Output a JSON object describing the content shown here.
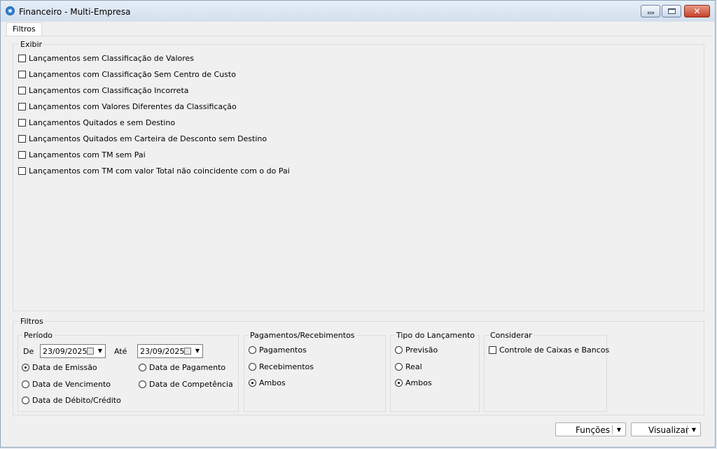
{
  "window": {
    "title": "Financeiro - Multi-Empresa"
  },
  "tabs": [
    {
      "label": "Filtros"
    }
  ],
  "exibir": {
    "caption": "Exibir",
    "items": [
      {
        "label": "Lançamentos sem Classificação de Valores",
        "checked": false
      },
      {
        "label": "Lançamentos com Classificação Sem Centro de Custo",
        "checked": false
      },
      {
        "label": "Lançamentos com Classificação Incorreta",
        "checked": false
      },
      {
        "label": "Lançamentos com Valores Diferentes da Classificação",
        "checked": false
      },
      {
        "label": "Lançamentos Quitados e sem Destino",
        "checked": false
      },
      {
        "label": "Lançamentos Quitados em Carteira de Desconto sem Destino",
        "checked": false
      },
      {
        "label": "Lançamentos com TM sem Pai",
        "checked": false
      },
      {
        "label": "Lançamentos com TM com valor Total não coincidente com o do Pai",
        "checked": false
      }
    ]
  },
  "filtros": {
    "caption": "Filtros",
    "periodo": {
      "caption": "Período",
      "de_label": "De",
      "de_value": "23/09/2025",
      "ate_label": "Até",
      "ate_value": "23/09/2025",
      "options": [
        {
          "label": "Data de Emissão",
          "selected": true
        },
        {
          "label": "Data de Pagamento",
          "selected": false
        },
        {
          "label": "Data de Vencimento",
          "selected": false
        },
        {
          "label": "Data de Competência",
          "selected": false
        },
        {
          "label": "Data de Débito/Crédito",
          "selected": false
        }
      ]
    },
    "pagamentos": {
      "caption": "Pagamentos/Recebimentos",
      "options": [
        {
          "label": "Pagamentos",
          "selected": false
        },
        {
          "label": "Recebimentos",
          "selected": false
        },
        {
          "label": "Ambos",
          "selected": true
        }
      ]
    },
    "tipo": {
      "caption": "Tipo do Lançamento",
      "options": [
        {
          "label": "Previsão",
          "selected": false
        },
        {
          "label": "Real",
          "selected": false
        },
        {
          "label": "Ambos",
          "selected": true
        }
      ]
    },
    "considerar": {
      "caption": "Considerar",
      "items": [
        {
          "label": "Controle de Caixas e Bancos",
          "checked": false
        }
      ]
    }
  },
  "buttons": {
    "funcoes": "Funções",
    "visualizar": "Visualizar"
  },
  "icons": {
    "app": "app-logo-icon",
    "calendar": "calendar-icon",
    "dropdown": "chevron-down-icon"
  }
}
